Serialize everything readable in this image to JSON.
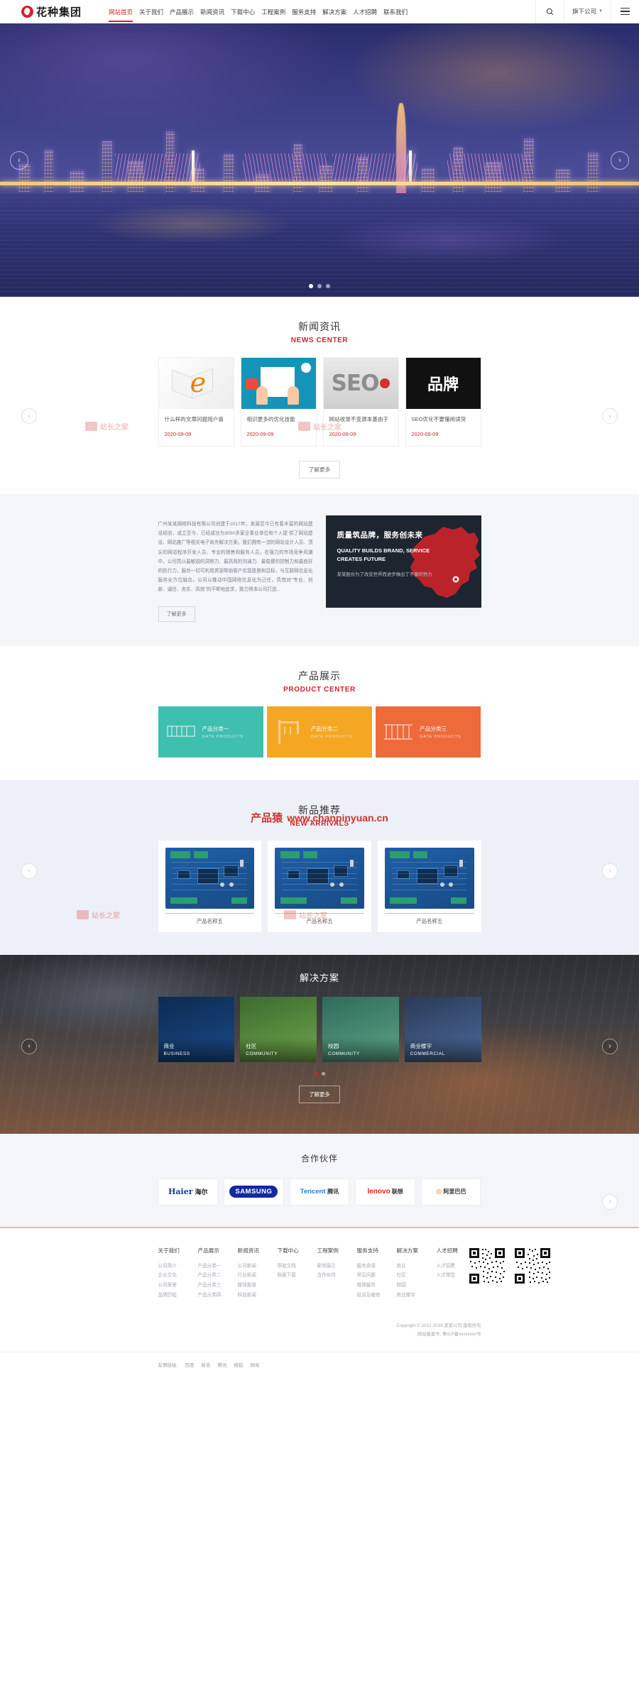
{
  "header": {
    "logo_text": "花种集团",
    "nav": [
      {
        "label": "网站首页",
        "active": true
      },
      {
        "label": "关于我们",
        "active": false
      },
      {
        "label": "产品展示",
        "active": false
      },
      {
        "label": "新闻资讯",
        "active": false
      },
      {
        "label": "下载中心",
        "active": false
      },
      {
        "label": "工程案例",
        "active": false
      },
      {
        "label": "服务支持",
        "active": false
      },
      {
        "label": "解决方案",
        "active": false
      },
      {
        "label": "人才招聘",
        "active": false
      },
      {
        "label": "联系我们",
        "active": false
      }
    ],
    "search_icon": "search-icon",
    "sub_company_label": "旗下公司",
    "menu_icon": "hamburger-menu-icon",
    "accent_color": "#d2232a"
  },
  "banner": {
    "prev_label": "‹",
    "next_label": "›",
    "dots": 3,
    "active_dot": 0
  },
  "news": {
    "title_cn": "新闻资讯",
    "title_en": "NEWS CENTER",
    "items": [
      {
        "title": "什么样的文章问题用户喜好?",
        "date": "2020-09-09"
      },
      {
        "title": "相识更多的优化技能",
        "date": "2020-09-09"
      },
      {
        "title": "网站收录不变源本基由于这些",
        "date": "2020-09-09"
      },
      {
        "title": "SEO优化不要懂阅读货",
        "date": "2020-09-09"
      }
    ],
    "more_label": "了解更多",
    "prev_label": "‹",
    "next_label": "›",
    "thumb_text": {
      "seo": "SEO",
      "brand": "品牌"
    }
  },
  "about": {
    "text": "广州某某网络科技有限公司创建于2017年，发展至今已有着丰富的网站建设经验，成立至今，已经成功为3000多家企事业单位和个人提 供了网站建设、网站推广等相关电子商务解决方案。我们拥有一流的网站设计人员、顶尖的网站程序开发人员、专业的销售和服务人员，在强力的市场竞争风潮中，公司凭以最敏锐的洞察力、最高效的沟通力、最稳健的控制力和最良好的执行力，服务一切可利用资源帮助客户实现愿景和目标，与互联网信息化服务全方位融合。公司以推动中国网络信息化为己任，凭借对\"专业、创新、诚信、务实、高效\"的不断地追求，致力将本公司打造...",
    "more_label": "了解更多",
    "card": {
      "title_cn": "质量筑品牌，服务创未来",
      "title_en_line1": "QUALITY BUILDS BRAND, SERVICE",
      "title_en_line2": "CREATES FUTURE",
      "desc": "某某股份为了改变世界而进步做出了不懈的努力"
    }
  },
  "products": {
    "title_cn": "产品展示",
    "title_en": "PRODUCT CENTER",
    "items": [
      {
        "name": "产品分类一",
        "sub": "GATE PRODUCTS",
        "color": "#3fbfae"
      },
      {
        "name": "产品分类二",
        "sub": "GATE PRODUCTS",
        "color": "#f5a623"
      },
      {
        "name": "产品分类三",
        "sub": "GATE PRODUCTS",
        "color": "#ee6a3a"
      }
    ],
    "watermark_cn": "产品猿",
    "watermark_url": "www.chanpinyuan.cn"
  },
  "arrivals": {
    "title_cn": "新品推荐",
    "title_en": "NEW ARRIVALS",
    "items": [
      {
        "name": "产品名称五"
      },
      {
        "name": "产品名称五"
      },
      {
        "name": "产品名称五"
      }
    ],
    "prev_label": "‹",
    "next_label": "›"
  },
  "solutions": {
    "title_cn": "解决方案",
    "items": [
      {
        "name_cn": "商业",
        "name_en": "BUSINESS"
      },
      {
        "name_cn": "社区",
        "name_en": "COMMUNITY"
      },
      {
        "name_cn": "校园",
        "name_en": "COMMUNITY"
      },
      {
        "name_cn": "商业楼宇",
        "name_en": "COMMERCIAL"
      }
    ],
    "dots": 2,
    "active_dot": 0,
    "more_label": "了解更多",
    "prev_label": "‹",
    "next_label": "›"
  },
  "partners": {
    "title_cn": "合作伙伴",
    "items": [
      {
        "name": "Haier",
        "cn": "海尔"
      },
      {
        "name": "SAMSUNG",
        "cn": ""
      },
      {
        "name": "Tencent",
        "cn": "腾讯"
      },
      {
        "name": "lenovo",
        "cn": "联想"
      },
      {
        "name": "阿里巴巴",
        "cn": "阿里巴巴"
      }
    ],
    "next_label": "›"
  },
  "footer": {
    "columns": [
      {
        "head": "关于我们",
        "links": [
          "公司简介",
          "企业文化",
          "公司荣誉",
          "品牌历程"
        ]
      },
      {
        "head": "产品展示",
        "links": [
          "产品分类一",
          "产品分类二",
          "产品分类三",
          "产品分类四"
        ]
      },
      {
        "head": "新闻资讯",
        "links": [
          "公司新闻",
          "行业新闻",
          "媒体报道",
          "科技新闻"
        ]
      },
      {
        "head": "下载中心",
        "links": [
          "帮助文档",
          "档案下载"
        ]
      },
      {
        "head": "工程案例",
        "links": [
          "案例展示",
          "合作伙伴"
        ]
      },
      {
        "head": "服务支持",
        "links": [
          "服务承诺",
          "常见问题",
          "维保服务",
          "投诉及维修"
        ]
      },
      {
        "head": "解决方案",
        "links": [
          "商业",
          "社区",
          "校园",
          "商业楼宇"
        ]
      },
      {
        "head": "人才招聘",
        "links": [
          "人才招聘",
          "人才理念"
        ]
      }
    ],
    "copyright": "Copyright © 2012-2018 某某公司 版权所有",
    "icp": "网站备案号: 粤ICP备xxxxxxxx号",
    "qr_count": 2,
    "bottom_links": [
      "友情链接:",
      "百度",
      "新浪",
      "腾讯",
      "搜狐",
      "网易"
    ]
  }
}
